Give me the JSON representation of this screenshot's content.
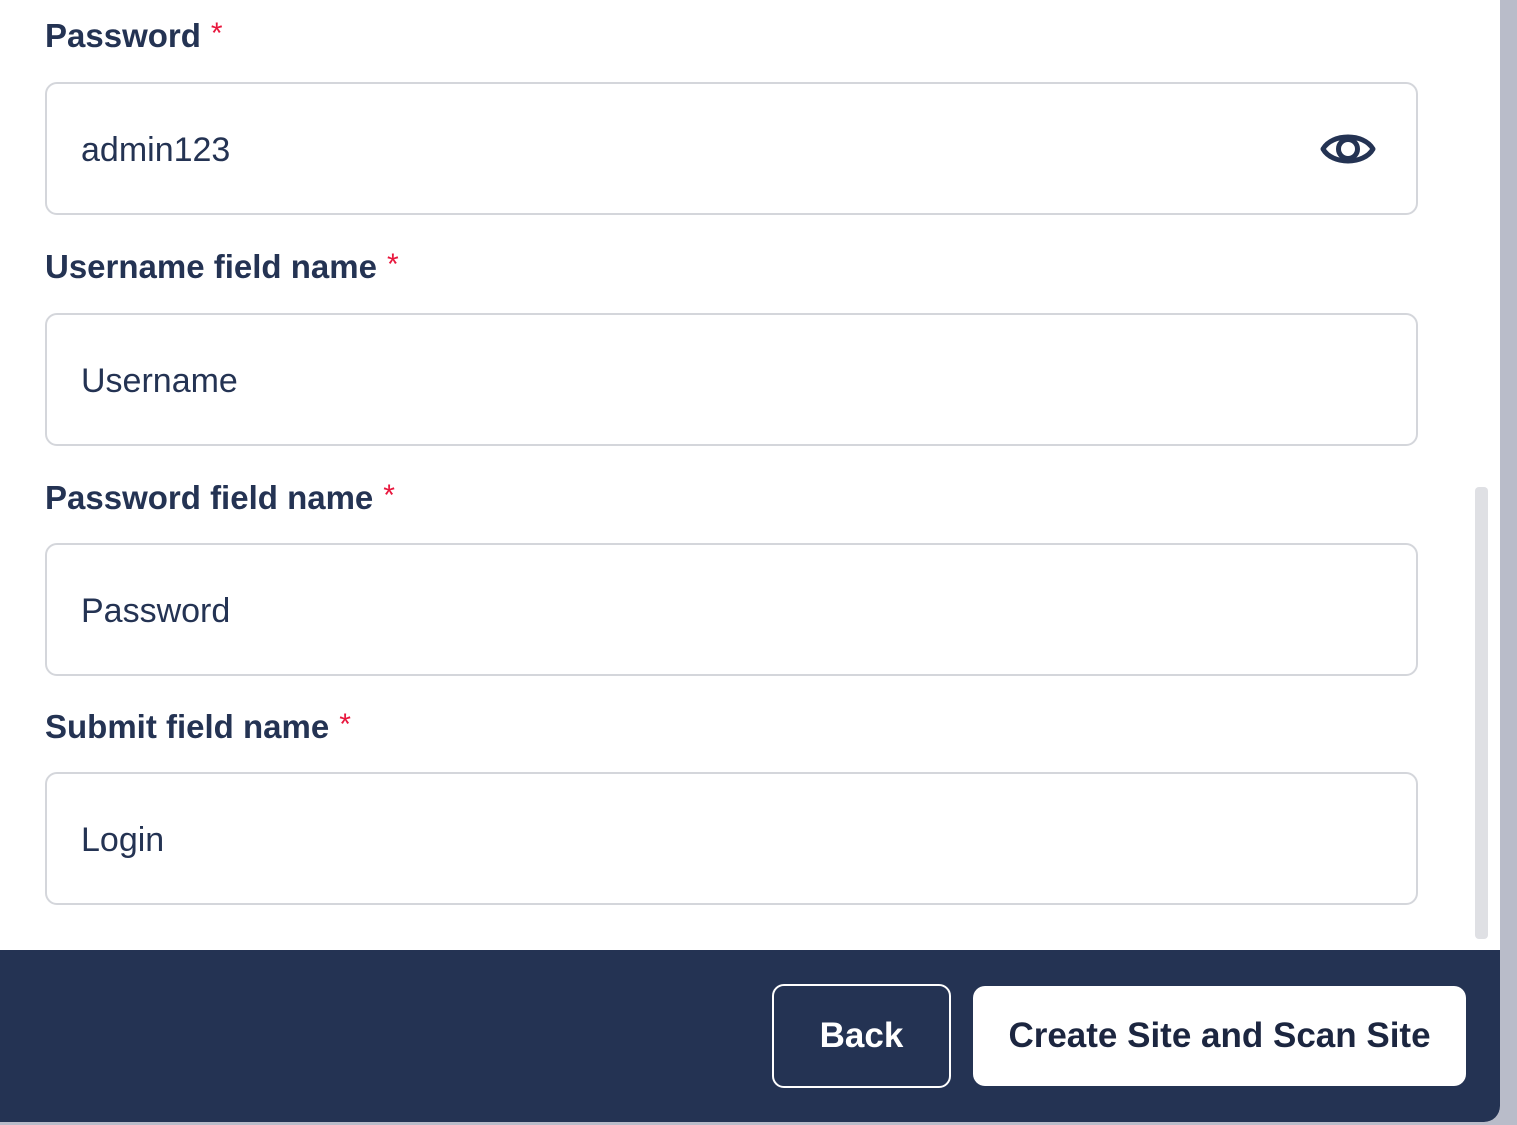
{
  "form": {
    "fields": [
      {
        "label": "Password",
        "required_mark": "*",
        "value": "admin123",
        "icon": "eye-icon"
      },
      {
        "label": "Username field name",
        "required_mark": "*",
        "value": "Username"
      },
      {
        "label": "Password field name",
        "required_mark": "*",
        "value": "Password"
      },
      {
        "label": "Submit field name",
        "required_mark": "*",
        "value": "Login"
      }
    ]
  },
  "footer": {
    "back_label": "Back",
    "create_label": "Create Site and Scan Site"
  },
  "colors": {
    "navy": "#243353",
    "required": "#e8173d",
    "border": "#d4d6db"
  }
}
